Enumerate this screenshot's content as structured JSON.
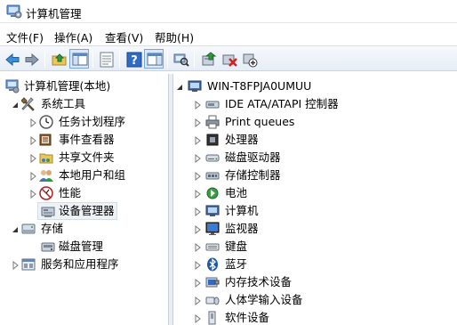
{
  "window": {
    "title": "计算机管理"
  },
  "menu": [
    {
      "label": "文件(F)"
    },
    {
      "label": "操作(A)"
    },
    {
      "label": "查看(V)"
    },
    {
      "label": "帮助(H)"
    }
  ],
  "toolbar": {
    "buttons": [
      {
        "icon": "back-arrow-icon"
      },
      {
        "icon": "forward-arrow-icon"
      },
      {
        "icon": "up-folder-icon"
      },
      {
        "icon": "show-hide-console-tree-icon",
        "pressed": true
      },
      {
        "icon": "properties-icon"
      },
      {
        "icon": "help-icon"
      },
      {
        "icon": "show-action-pane-icon",
        "pressed": true
      },
      {
        "icon": "scan-hardware-icon"
      },
      {
        "icon": "update-driver-icon"
      },
      {
        "icon": "uninstall-device-icon"
      },
      {
        "icon": "enable-device-icon"
      }
    ]
  },
  "left_tree": {
    "root": "计算机管理(本地)",
    "items": [
      {
        "label": "系统工具",
        "icon": "tools-icon",
        "expanded": true
      },
      {
        "label": "任务计划程序",
        "icon": "clock-icon"
      },
      {
        "label": "事件查看器",
        "icon": "event-viewer-icon"
      },
      {
        "label": "共享文件夹",
        "icon": "shared-folder-icon"
      },
      {
        "label": "本地用户和组",
        "icon": "users-icon"
      },
      {
        "label": "性能",
        "icon": "performance-icon"
      },
      {
        "label": "设备管理器",
        "icon": "device-manager-icon",
        "selected": true
      },
      {
        "label": "存储",
        "icon": "storage-icon",
        "expanded": true
      },
      {
        "label": "磁盘管理",
        "icon": "disk-management-icon"
      },
      {
        "label": "服务和应用程序",
        "icon": "services-icon"
      }
    ]
  },
  "device_tree": {
    "computer": "WIN-T8FPJA0UMUU",
    "categories": [
      {
        "label": "IDE ATA/ATAPI 控制器",
        "icon": "ide-controller-icon"
      },
      {
        "label": "Print queues",
        "icon": "printer-icon"
      },
      {
        "label": "处理器",
        "icon": "processor-icon"
      },
      {
        "label": "磁盘驱动器",
        "icon": "disk-drive-icon"
      },
      {
        "label": "存储控制器",
        "icon": "storage-controller-icon"
      },
      {
        "label": "电池",
        "icon": "battery-icon"
      },
      {
        "label": "计算机",
        "icon": "computer-icon"
      },
      {
        "label": "监视器",
        "icon": "monitor-icon"
      },
      {
        "label": "键盘",
        "icon": "keyboard-icon"
      },
      {
        "label": "蓝牙",
        "icon": "bluetooth-icon"
      },
      {
        "label": "内存技术设备",
        "icon": "memory-device-icon"
      },
      {
        "label": "人体学输入设备",
        "icon": "hid-icon"
      },
      {
        "label": "软件设备",
        "icon": "software-device-icon"
      }
    ]
  }
}
